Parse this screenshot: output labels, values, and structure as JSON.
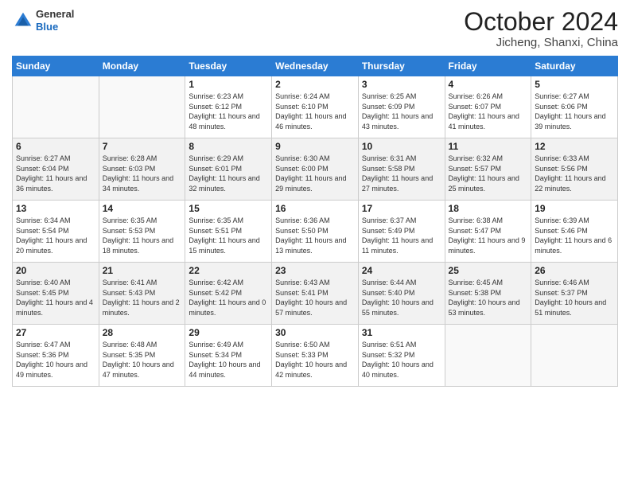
{
  "header": {
    "logo": {
      "general": "General",
      "blue": "Blue"
    },
    "title": "October 2024",
    "location": "Jicheng, Shanxi, China"
  },
  "days_of_week": [
    "Sunday",
    "Monday",
    "Tuesday",
    "Wednesday",
    "Thursday",
    "Friday",
    "Saturday"
  ],
  "weeks": [
    [
      {
        "day": "",
        "sunrise": "",
        "sunset": "",
        "daylight": ""
      },
      {
        "day": "",
        "sunrise": "",
        "sunset": "",
        "daylight": ""
      },
      {
        "day": "1",
        "sunrise": "Sunrise: 6:23 AM",
        "sunset": "Sunset: 6:12 PM",
        "daylight": "Daylight: 11 hours and 48 minutes."
      },
      {
        "day": "2",
        "sunrise": "Sunrise: 6:24 AM",
        "sunset": "Sunset: 6:10 PM",
        "daylight": "Daylight: 11 hours and 46 minutes."
      },
      {
        "day": "3",
        "sunrise": "Sunrise: 6:25 AM",
        "sunset": "Sunset: 6:09 PM",
        "daylight": "Daylight: 11 hours and 43 minutes."
      },
      {
        "day": "4",
        "sunrise": "Sunrise: 6:26 AM",
        "sunset": "Sunset: 6:07 PM",
        "daylight": "Daylight: 11 hours and 41 minutes."
      },
      {
        "day": "5",
        "sunrise": "Sunrise: 6:27 AM",
        "sunset": "Sunset: 6:06 PM",
        "daylight": "Daylight: 11 hours and 39 minutes."
      }
    ],
    [
      {
        "day": "6",
        "sunrise": "Sunrise: 6:27 AM",
        "sunset": "Sunset: 6:04 PM",
        "daylight": "Daylight: 11 hours and 36 minutes."
      },
      {
        "day": "7",
        "sunrise": "Sunrise: 6:28 AM",
        "sunset": "Sunset: 6:03 PM",
        "daylight": "Daylight: 11 hours and 34 minutes."
      },
      {
        "day": "8",
        "sunrise": "Sunrise: 6:29 AM",
        "sunset": "Sunset: 6:01 PM",
        "daylight": "Daylight: 11 hours and 32 minutes."
      },
      {
        "day": "9",
        "sunrise": "Sunrise: 6:30 AM",
        "sunset": "Sunset: 6:00 PM",
        "daylight": "Daylight: 11 hours and 29 minutes."
      },
      {
        "day": "10",
        "sunrise": "Sunrise: 6:31 AM",
        "sunset": "Sunset: 5:58 PM",
        "daylight": "Daylight: 11 hours and 27 minutes."
      },
      {
        "day": "11",
        "sunrise": "Sunrise: 6:32 AM",
        "sunset": "Sunset: 5:57 PM",
        "daylight": "Daylight: 11 hours and 25 minutes."
      },
      {
        "day": "12",
        "sunrise": "Sunrise: 6:33 AM",
        "sunset": "Sunset: 5:56 PM",
        "daylight": "Daylight: 11 hours and 22 minutes."
      }
    ],
    [
      {
        "day": "13",
        "sunrise": "Sunrise: 6:34 AM",
        "sunset": "Sunset: 5:54 PM",
        "daylight": "Daylight: 11 hours and 20 minutes."
      },
      {
        "day": "14",
        "sunrise": "Sunrise: 6:35 AM",
        "sunset": "Sunset: 5:53 PM",
        "daylight": "Daylight: 11 hours and 18 minutes."
      },
      {
        "day": "15",
        "sunrise": "Sunrise: 6:35 AM",
        "sunset": "Sunset: 5:51 PM",
        "daylight": "Daylight: 11 hours and 15 minutes."
      },
      {
        "day": "16",
        "sunrise": "Sunrise: 6:36 AM",
        "sunset": "Sunset: 5:50 PM",
        "daylight": "Daylight: 11 hours and 13 minutes."
      },
      {
        "day": "17",
        "sunrise": "Sunrise: 6:37 AM",
        "sunset": "Sunset: 5:49 PM",
        "daylight": "Daylight: 11 hours and 11 minutes."
      },
      {
        "day": "18",
        "sunrise": "Sunrise: 6:38 AM",
        "sunset": "Sunset: 5:47 PM",
        "daylight": "Daylight: 11 hours and 9 minutes."
      },
      {
        "day": "19",
        "sunrise": "Sunrise: 6:39 AM",
        "sunset": "Sunset: 5:46 PM",
        "daylight": "Daylight: 11 hours and 6 minutes."
      }
    ],
    [
      {
        "day": "20",
        "sunrise": "Sunrise: 6:40 AM",
        "sunset": "Sunset: 5:45 PM",
        "daylight": "Daylight: 11 hours and 4 minutes."
      },
      {
        "day": "21",
        "sunrise": "Sunrise: 6:41 AM",
        "sunset": "Sunset: 5:43 PM",
        "daylight": "Daylight: 11 hours and 2 minutes."
      },
      {
        "day": "22",
        "sunrise": "Sunrise: 6:42 AM",
        "sunset": "Sunset: 5:42 PM",
        "daylight": "Daylight: 11 hours and 0 minutes."
      },
      {
        "day": "23",
        "sunrise": "Sunrise: 6:43 AM",
        "sunset": "Sunset: 5:41 PM",
        "daylight": "Daylight: 10 hours and 57 minutes."
      },
      {
        "day": "24",
        "sunrise": "Sunrise: 6:44 AM",
        "sunset": "Sunset: 5:40 PM",
        "daylight": "Daylight: 10 hours and 55 minutes."
      },
      {
        "day": "25",
        "sunrise": "Sunrise: 6:45 AM",
        "sunset": "Sunset: 5:38 PM",
        "daylight": "Daylight: 10 hours and 53 minutes."
      },
      {
        "day": "26",
        "sunrise": "Sunrise: 6:46 AM",
        "sunset": "Sunset: 5:37 PM",
        "daylight": "Daylight: 10 hours and 51 minutes."
      }
    ],
    [
      {
        "day": "27",
        "sunrise": "Sunrise: 6:47 AM",
        "sunset": "Sunset: 5:36 PM",
        "daylight": "Daylight: 10 hours and 49 minutes."
      },
      {
        "day": "28",
        "sunrise": "Sunrise: 6:48 AM",
        "sunset": "Sunset: 5:35 PM",
        "daylight": "Daylight: 10 hours and 47 minutes."
      },
      {
        "day": "29",
        "sunrise": "Sunrise: 6:49 AM",
        "sunset": "Sunset: 5:34 PM",
        "daylight": "Daylight: 10 hours and 44 minutes."
      },
      {
        "day": "30",
        "sunrise": "Sunrise: 6:50 AM",
        "sunset": "Sunset: 5:33 PM",
        "daylight": "Daylight: 10 hours and 42 minutes."
      },
      {
        "day": "31",
        "sunrise": "Sunrise: 6:51 AM",
        "sunset": "Sunset: 5:32 PM",
        "daylight": "Daylight: 10 hours and 40 minutes."
      },
      {
        "day": "",
        "sunrise": "",
        "sunset": "",
        "daylight": ""
      },
      {
        "day": "",
        "sunrise": "",
        "sunset": "",
        "daylight": ""
      }
    ]
  ]
}
